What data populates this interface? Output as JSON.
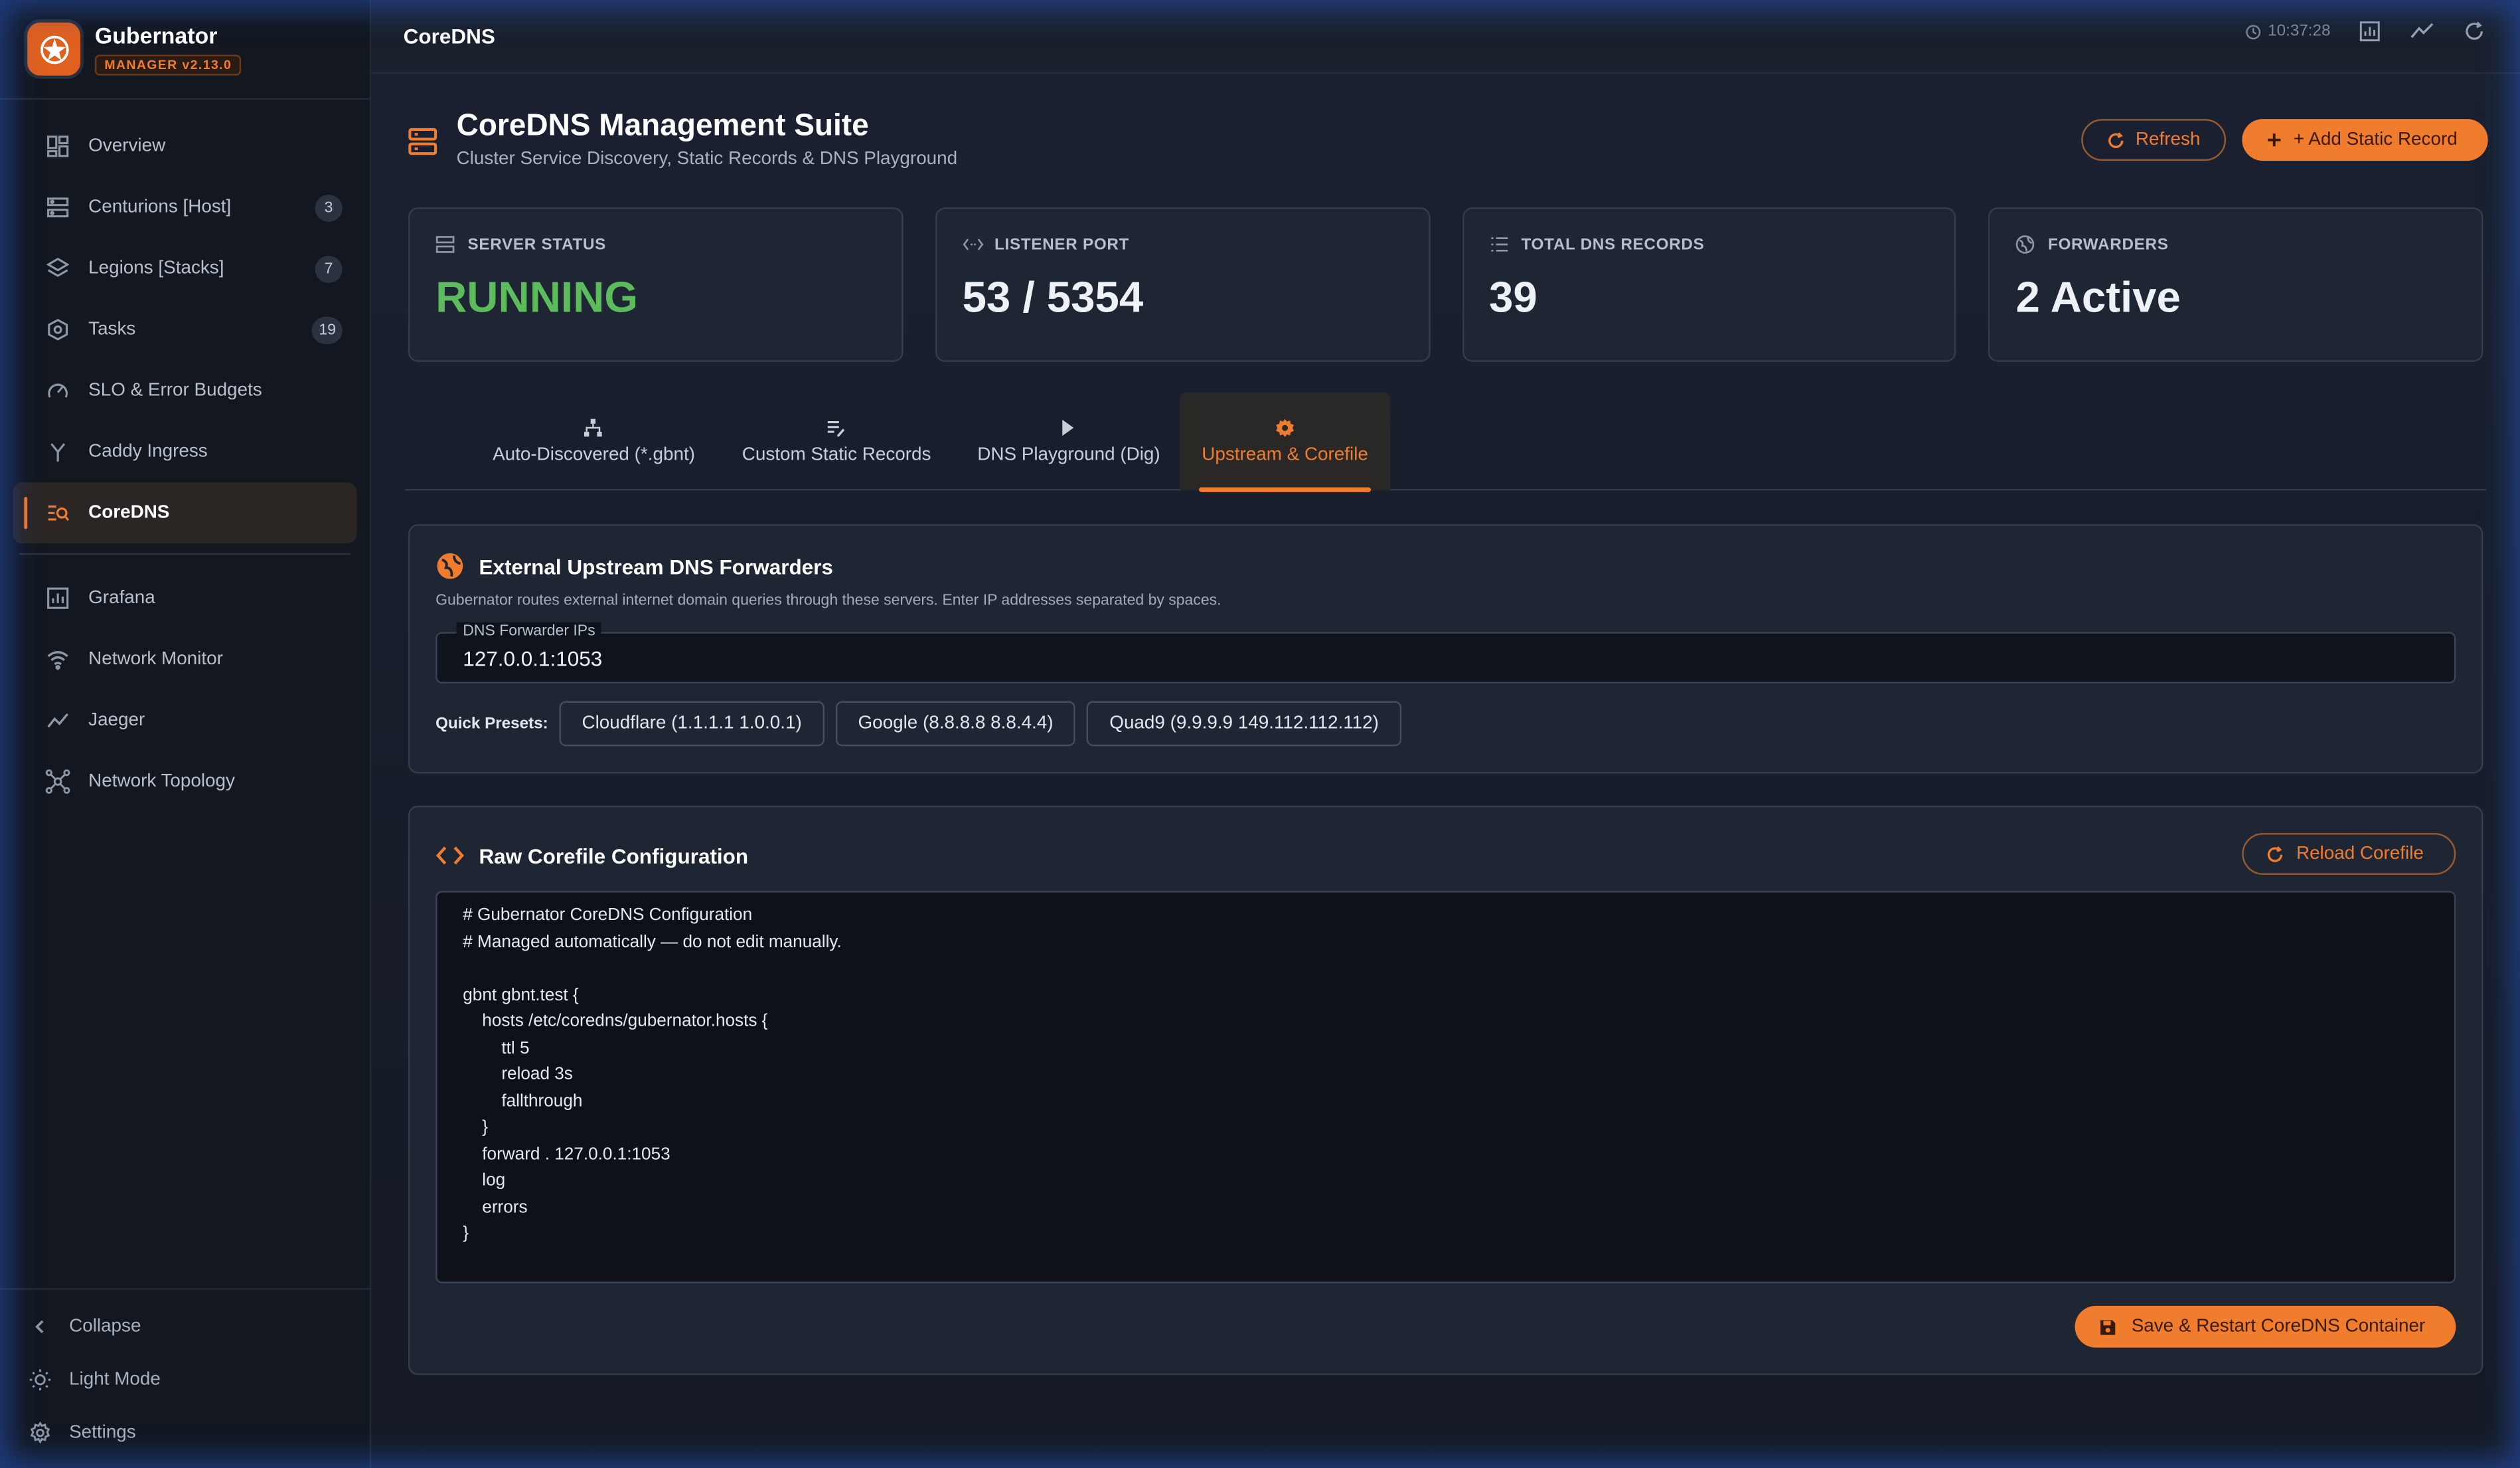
{
  "brand": {
    "name": "Gubernator",
    "version": "MANAGER v2.13.0"
  },
  "sidebar": {
    "items": [
      {
        "label": "Overview",
        "icon": "dashboard-icon",
        "count": ""
      },
      {
        "label": "Centurions [Host]",
        "icon": "server-icon",
        "count": "3"
      },
      {
        "label": "Legions [Stacks]",
        "icon": "layers-icon",
        "count": "7"
      },
      {
        "label": "Tasks",
        "icon": "hexagon-icon",
        "count": "19"
      },
      {
        "label": "SLO & Error Budgets",
        "icon": "gauge-icon",
        "count": ""
      },
      {
        "label": "Caddy Ingress",
        "icon": "fork-icon",
        "count": ""
      },
      {
        "label": "CoreDNS",
        "icon": "dns-search-icon",
        "count": "",
        "active": true
      }
    ],
    "items2": [
      {
        "label": "Grafana",
        "icon": "chart-icon"
      },
      {
        "label": "Network Monitor",
        "icon": "wifi-icon"
      },
      {
        "label": "Jaeger",
        "icon": "trend-icon"
      },
      {
        "label": "Network Topology",
        "icon": "topology-icon"
      }
    ],
    "bottom": {
      "collapse": "Collapse",
      "theme": "Light Mode",
      "settings": "Settings"
    }
  },
  "topbar": {
    "title": "CoreDNS",
    "time": "10:37:28"
  },
  "page": {
    "title": "CoreDNS Management Suite",
    "subtitle": "Cluster Service Discovery, Static Records & DNS Playground",
    "refresh_label": "Refresh",
    "add_label": "+ Add Static Record"
  },
  "stats": [
    {
      "label": "SERVER STATUS",
      "value": "RUNNING",
      "icon": "server-icon"
    },
    {
      "label": "LISTENER PORT",
      "value": "53 / 5354",
      "icon": "code-arrows-icon"
    },
    {
      "label": "TOTAL DNS RECORDS",
      "value": "39",
      "icon": "list-icon"
    },
    {
      "label": "FORWARDERS",
      "value": "2 Active",
      "icon": "globe-icon"
    }
  ],
  "tabs": [
    {
      "label": "Auto-Discovered (*.gbnt)",
      "icon": "sitemap-icon"
    },
    {
      "label": "Custom Static Records",
      "icon": "edit-list-icon"
    },
    {
      "label": "DNS Playground (Dig)",
      "icon": "play-icon"
    },
    {
      "label": "Upstream & Corefile",
      "icon": "gear-icon",
      "active": true
    }
  ],
  "forwarders": {
    "title": "External Upstream DNS Forwarders",
    "description": "Gubernator routes external internet domain queries through these servers. Enter IP addresses separated by spaces.",
    "field_label": "DNS Forwarder IPs",
    "field_value": "127.0.0.1:1053",
    "presets_label": "Quick Presets:",
    "presets": [
      "Cloudflare (1.1.1.1 1.0.0.1)",
      "Google (8.8.8.8 8.8.4.4)",
      "Quad9 (9.9.9.9 149.112.112.112)"
    ]
  },
  "corefile": {
    "title": "Raw Corefile Configuration",
    "reload_label": "Reload Corefile",
    "content": "# Gubernator CoreDNS Configuration\n# Managed automatically — do not edit manually.\n\ngbnt gbnt.test {\n    hosts /etc/coredns/gubernator.hosts {\n        ttl 5\n        reload 3s\n        fallthrough\n    }\n    forward . 127.0.0.1:1053\n    log\n    errors\n}",
    "save_label": "Save & Restart CoreDNS Container"
  },
  "colors": {
    "accent": "#f07c2d",
    "success": "#5cbb5a",
    "background": "#171c25"
  }
}
